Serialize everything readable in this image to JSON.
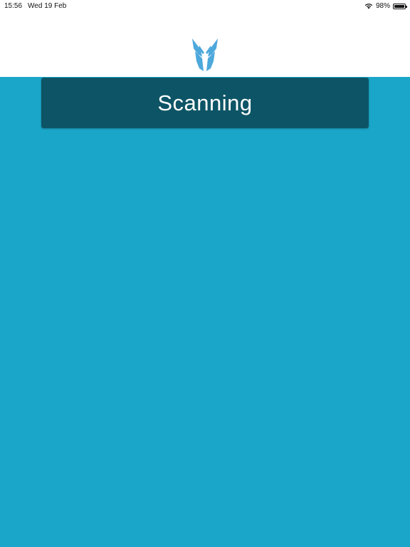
{
  "status_bar": {
    "time": "15:56",
    "date": "Wed 19 Feb",
    "battery_percent": "98%",
    "battery_level": 0.98,
    "icons": [
      "wifi-icon",
      "battery-icon"
    ]
  },
  "header": {
    "logo_icon": "deer-head-logo-icon",
    "logo_color": "#4da8dc"
  },
  "banner": {
    "title": "Scanning"
  },
  "colors": {
    "background": "#1aa6c9",
    "banner": "#0d5566",
    "header": "#ffffff"
  }
}
